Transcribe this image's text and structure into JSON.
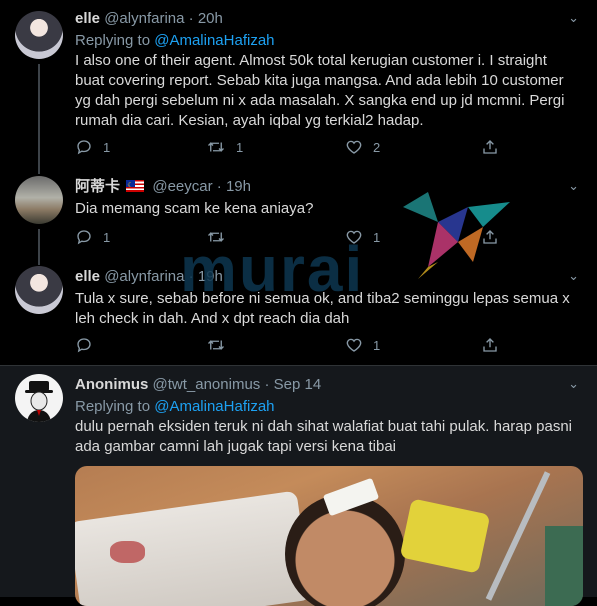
{
  "thread": [
    {
      "name": "elle",
      "handle": "@alynfarina",
      "time": "20h",
      "replying_label": "Replying to",
      "replying_to": "@AmalinaHafizah",
      "text": "I also one of their agent. Almost 50k total kerugian customer i. I straight buat covering report. Sebab kita juga mangsa. And ada lebih 10 customer yg dah pergi sebelum ni x ada masalah. X sangka end up jd mcmni. Pergi rumah dia cari. Kesian, ayah iqbal yg terkial2 hadap.",
      "replies": "1",
      "retweets": "1",
      "likes": "2"
    },
    {
      "name": "阿蒂卡",
      "handle": "@eeycar",
      "time": "19h",
      "text": "Dia memang scam ke kena aniaya?",
      "replies": "1",
      "retweets": "",
      "likes": "1"
    },
    {
      "name": "elle",
      "handle": "@alynfarina",
      "time": "19h",
      "text": "Tula x sure, sebab before ni semua ok, and tiba2 seminggu lepas semua x leh check in dah. And x dpt reach dia dah",
      "replies": "",
      "retweets": "",
      "likes": "1"
    }
  ],
  "second": {
    "name": "Anonimus",
    "handle": "@twt_anonimus",
    "time": "Sep 14",
    "replying_label": "Replying to",
    "replying_to": "@AmalinaHafizah",
    "text": "dulu pernah eksiden teruk ni dah sihat walafiat buat tahi pulak. harap pasni ada gambar camni lah jugak tapi versi kena tibai"
  },
  "dot": "·",
  "chevron": "⌄",
  "watermark": "murai",
  "colors": {
    "background": "#000000",
    "text": "#d9d9d9",
    "muted": "#8899a6",
    "link": "#1da1f2",
    "separator": "#2f3336"
  }
}
